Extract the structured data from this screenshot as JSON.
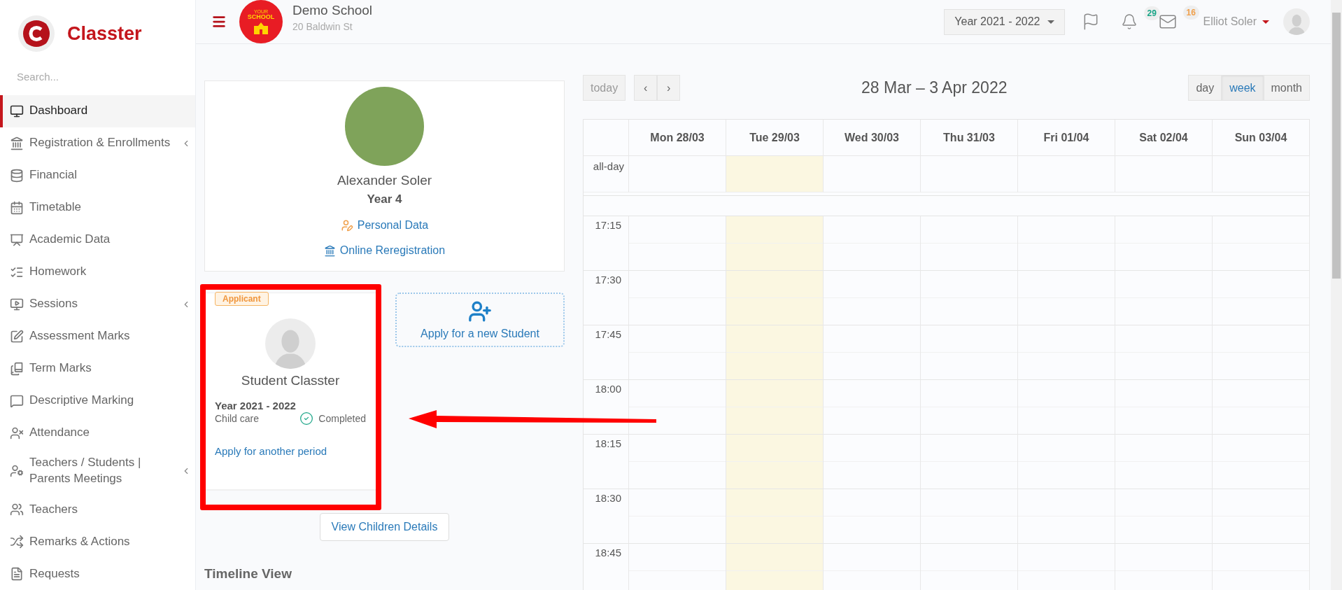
{
  "brand": {
    "name": "Classter"
  },
  "sidebar": {
    "search_placeholder": "Search...",
    "items": [
      {
        "label": "Dashboard",
        "selected": true,
        "has_submenu": false
      },
      {
        "label": "Registration & Enrollments",
        "selected": false,
        "has_submenu": true
      },
      {
        "label": "Financial",
        "selected": false,
        "has_submenu": false
      },
      {
        "label": "Timetable",
        "selected": false,
        "has_submenu": false
      },
      {
        "label": "Academic Data",
        "selected": false,
        "has_submenu": false
      },
      {
        "label": "Homework",
        "selected": false,
        "has_submenu": false
      },
      {
        "label": "Sessions",
        "selected": false,
        "has_submenu": true
      },
      {
        "label": "Assessment Marks",
        "selected": false,
        "has_submenu": false
      },
      {
        "label": "Term Marks",
        "selected": false,
        "has_submenu": false
      },
      {
        "label": "Descriptive Marking",
        "selected": false,
        "has_submenu": false
      },
      {
        "label": "Attendance",
        "selected": false,
        "has_submenu": false
      },
      {
        "label": "Teachers / Students | Parents Meetings",
        "selected": false,
        "has_submenu": true
      },
      {
        "label": "Teachers",
        "selected": false,
        "has_submenu": false
      },
      {
        "label": "Remarks & Actions",
        "selected": false,
        "has_submenu": false
      },
      {
        "label": "Requests",
        "selected": false,
        "has_submenu": false
      }
    ]
  },
  "header": {
    "logo_line_1": "YOUR",
    "logo_line_2": "SCHOOL",
    "school_name": "Demo School",
    "school_address": "20 Baldwin St",
    "year_selector": "Year 2021 - 2022",
    "notifications_count": "29",
    "messages_count": "16",
    "user_name": "Elliot Soler"
  },
  "student_card": {
    "name": "Alexander Soler",
    "grade": "Year 4",
    "links": [
      "Personal Data",
      "Online Reregistration"
    ]
  },
  "applicant_card": {
    "badge": "Applicant",
    "name": "Student Classter",
    "year": "Year 2021 - 2022",
    "program": "Child care",
    "status": "Completed",
    "link": "Apply for another period"
  },
  "new_student": {
    "label": "Apply for a new Student"
  },
  "view_details_button": "View Children Details",
  "timeline_title": "Timeline View",
  "calendar": {
    "today_button": "today",
    "prev": "‹",
    "next": "›",
    "range": "28 Mar – 3 Apr 2022",
    "views": [
      {
        "label": "day",
        "selected": false
      },
      {
        "label": "week",
        "selected": true
      },
      {
        "label": "month",
        "selected": false
      }
    ],
    "days": [
      {
        "label": "Mon 28/03",
        "today": false
      },
      {
        "label": "Tue 29/03",
        "today": true
      },
      {
        "label": "Wed 30/03",
        "today": false
      },
      {
        "label": "Thu 31/03",
        "today": false
      },
      {
        "label": "Fri 01/04",
        "today": false
      },
      {
        "label": "Sat 02/04",
        "today": false
      },
      {
        "label": "Sun 03/04",
        "today": false
      }
    ],
    "all_day_label": "all-day",
    "times": [
      "17:15",
      "17:30",
      "17:45",
      "18:00",
      "18:15",
      "18:30",
      "18:45"
    ]
  }
}
